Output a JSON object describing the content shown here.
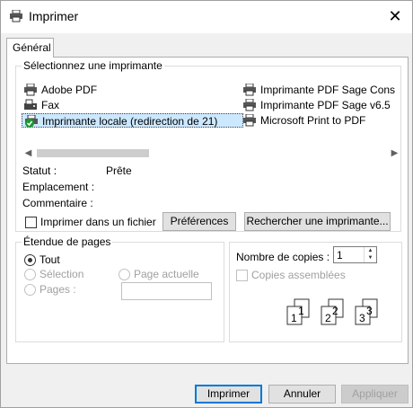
{
  "window": {
    "title": "Imprimer",
    "close_glyph": "✕"
  },
  "tab": {
    "label": "Général"
  },
  "printer_group": {
    "legend": "Sélectionnez une imprimante",
    "printers": [
      {
        "name": "Adobe PDF",
        "icon": "printer-icon"
      },
      {
        "name": "Fax",
        "icon": "fax-icon"
      },
      {
        "name": "Imprimante locale (redirection de 21)",
        "icon": "default-printer-icon",
        "selected": true
      },
      {
        "name": "Imprimante PDF Sage Cons",
        "icon": "printer-icon"
      },
      {
        "name": "Imprimante PDF Sage v6.5",
        "icon": "printer-icon"
      },
      {
        "name": "Microsoft Print to PDF",
        "icon": "printer-icon"
      }
    ],
    "status_label": "Statut :",
    "status_value": "Prête",
    "location_label": "Emplacement :",
    "comment_label": "Commentaire :",
    "print_to_file_label": "Imprimer dans un fichier",
    "preferences_label": "Préférences",
    "find_printer_label": "Rechercher une imprimante..."
  },
  "page_range": {
    "legend": "Étendue de pages",
    "all_label": "Tout",
    "selection_label": "Sélection",
    "current_page_label": "Page actuelle",
    "pages_label": "Pages :",
    "pages_value": ""
  },
  "copies": {
    "count_label": "Nombre de copies :",
    "count_value": "1",
    "collate_label": "Copies assemblées",
    "collate_digits": [
      "1",
      "1",
      "2",
      "2",
      "3",
      "3"
    ]
  },
  "footer": {
    "print_label": "Imprimer",
    "cancel_label": "Annuler",
    "apply_label": "Appliquer"
  }
}
